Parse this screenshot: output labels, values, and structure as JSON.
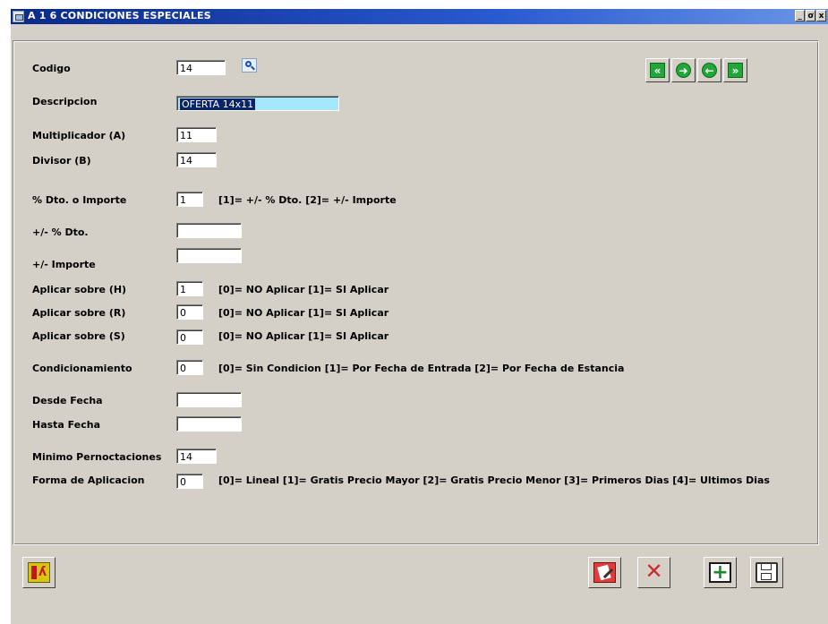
{
  "window": {
    "title": "A 1 6  CONDICIONES ESPECIALES",
    "controls": {
      "minimize": "_",
      "restore": "ơ",
      "close": "x"
    }
  },
  "form": {
    "codigo": {
      "label": "Codigo",
      "value": "14"
    },
    "descripcion": {
      "label": "Descripcion",
      "value": "OFERTA 14x11"
    },
    "multiplicador": {
      "label": "Multiplicador (A)",
      "value": "11"
    },
    "divisor": {
      "label": "Divisor (B)",
      "value": "14"
    },
    "dto_importe": {
      "label": "% Dto. o Importe",
      "value": "1",
      "hint": "[1]= +/- % Dto.   [2]= +/- Importe"
    },
    "dto": {
      "label": "+/-  % Dto.",
      "value": ""
    },
    "importe": {
      "label": "+/-  Importe",
      "value": ""
    },
    "aplicar_h": {
      "label": "Aplicar sobre (H)",
      "value": "1",
      "hint": "[0]= NO Aplicar   [1]= SI Aplicar"
    },
    "aplicar_r": {
      "label": "Aplicar sobre (R)",
      "value": "0",
      "hint": "[0]= NO Aplicar   [1]= SI Aplicar"
    },
    "aplicar_s": {
      "label": "Aplicar sobre (S)",
      "value": "0",
      "hint": "[0]= NO Aplicar   [1]= SI Aplicar"
    },
    "condicionamiento": {
      "label": "Condicionamiento",
      "value": "0",
      "hint": "[0]= Sin Condicion   [1]= Por Fecha de Entrada   [2]= Por Fecha de Estancia"
    },
    "desde_fecha": {
      "label": "Desde Fecha",
      "value": ""
    },
    "hasta_fecha": {
      "label": "Hasta Fecha",
      "value": ""
    },
    "minimo": {
      "label": "Minimo Pernoctaciones",
      "value": "14"
    },
    "forma": {
      "label": "Forma de Aplicacion",
      "value": "0",
      "hint": "[0]= Lineal   [1]= Gratis Precio Mayor   [2]= Gratis Precio Menor   [3]= Primeros Dias   [4]= Ultimos Dias"
    }
  },
  "nav": {
    "first_glyph": "«",
    "next_glyph": "➜",
    "prev_glyph": "←",
    "last_glyph": "»"
  },
  "icons": {
    "search": "search-icon",
    "first": "first-record-icon",
    "next": "next-record-icon",
    "prev": "previous-record-icon",
    "last": "last-record-icon",
    "exit": "exit-icon",
    "edit": "edit-icon",
    "delete": "delete-icon",
    "add": "add-icon",
    "save": "save-icon"
  },
  "colors": {
    "window_bg": "#d4d0c8",
    "titlebar": "#0a2a8a",
    "selection_bg": "#a6e8fb",
    "nav_green": "#22a63a"
  }
}
